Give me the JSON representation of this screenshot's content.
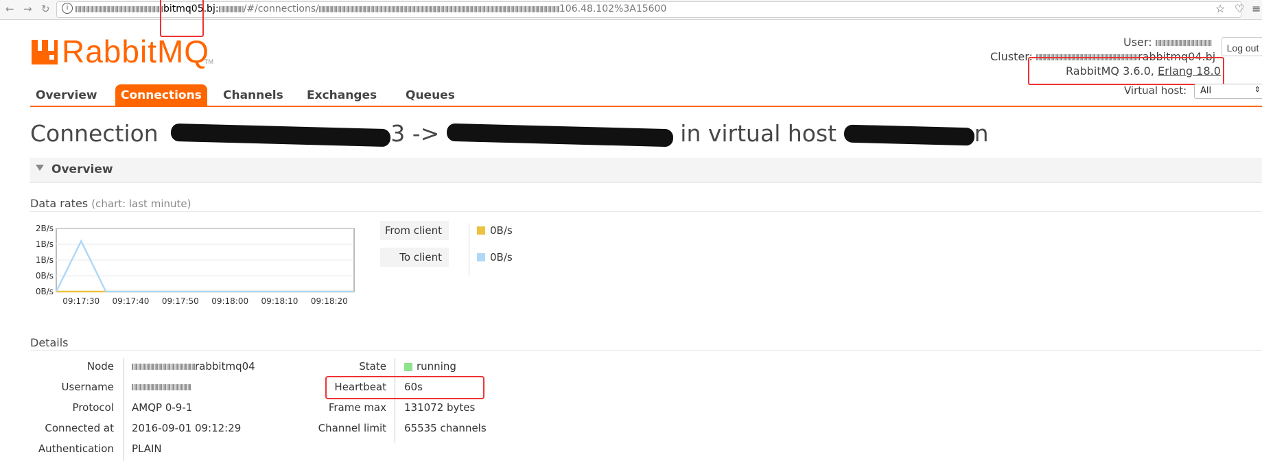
{
  "browser": {
    "url_host_end": "bitmq05.bj:",
    "url_path": "/#/connections/",
    "url_tail": "106.48.102%3A15600",
    "icons": [
      "back-icon",
      "forward-icon",
      "reload-icon",
      "info-icon",
      "star-icon",
      "pocket-icon",
      "menu-icon"
    ]
  },
  "logo": {
    "text": "RabbitMQ",
    "tm": "TM",
    "color": "#ff6600"
  },
  "header": {
    "user_label": "User:",
    "cluster_label": "Cluster:",
    "cluster_suffix": "rabbitmq04.bj",
    "version_prefix": "RabbitMQ 3.6.0, ",
    "erlang": "Erlang 18.0",
    "logout": "Log out",
    "vhost_label": "Virtual host:",
    "vhost_value": "All"
  },
  "tabs": [
    {
      "label": "Overview",
      "active": false
    },
    {
      "label": "Connections",
      "active": true
    },
    {
      "label": "Channels",
      "active": false
    },
    {
      "label": "Exchanges",
      "active": false
    },
    {
      "label": "Queues",
      "active": false
    }
  ],
  "title": {
    "prefix": "Connection",
    "arrow_frag": "3 -> ",
    "suffix": "in virtual host",
    "tail_frag": "n"
  },
  "section": {
    "title": "Overview"
  },
  "rates": {
    "heading": "Data rates",
    "note": "(chart: last minute)",
    "legend": [
      {
        "label": "From client",
        "value": "0B/s",
        "color": "#edc240"
      },
      {
        "label": "To client",
        "value": "0B/s",
        "color": "#afd8f8"
      }
    ]
  },
  "chart_data": {
    "type": "line",
    "ytick_labels": [
      "2B/s",
      "1B/s",
      "1B/s",
      "0B/s",
      "0B/s"
    ],
    "xtick_labels": [
      "09:17:30",
      "09:17:40",
      "09:17:50",
      "09:18:00",
      "09:18:10",
      "09:18:20"
    ],
    "ylim": [
      0,
      2
    ],
    "grid": true,
    "series": [
      {
        "name": "To client",
        "color": "#afd8f8",
        "x": [
          "09:17:25",
          "09:17:30",
          "09:17:35",
          "09:18:20",
          "09:18:25"
        ],
        "values": [
          0,
          1.6,
          0,
          0,
          0
        ]
      },
      {
        "name": "From client",
        "color": "#edc240",
        "x": [
          "09:17:25",
          "09:18:25"
        ],
        "values": [
          0,
          0
        ]
      }
    ]
  },
  "details": {
    "heading": "Details",
    "left": [
      {
        "label": "Node",
        "value": "rabbitmq04",
        "blur_prefix": true
      },
      {
        "label": "Username",
        "value": "",
        "blur_prefix": true
      },
      {
        "label": "Protocol",
        "value": "AMQP 0-9-1"
      },
      {
        "label": "Connected at",
        "value": "2016-09-01 09:12:29"
      },
      {
        "label": "Authentication",
        "value": "PLAIN"
      }
    ],
    "right": [
      {
        "label": "State",
        "value": "running"
      },
      {
        "label": "Heartbeat",
        "value": "60s"
      },
      {
        "label": "Frame max",
        "value": "131072 bytes"
      },
      {
        "label": "Channel limit",
        "value": "65535 channels"
      }
    ]
  }
}
